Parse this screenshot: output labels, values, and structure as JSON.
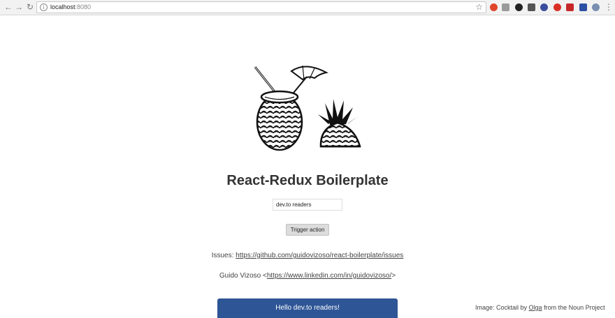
{
  "browser": {
    "url_host": "localhost",
    "url_port": ":8080"
  },
  "page": {
    "title": "React-Redux Boilerplate",
    "input_value": "dev.to readers",
    "trigger_label": "Trigger action",
    "issues_prefix": "Issues:",
    "issues_link": "https://github.com/guidovizoso/react-boilerplate/issues",
    "author_name": "Guido Vizoso <",
    "author_link": "https://www.linkedin.com/in/guidovizoso/",
    "author_suffix": ">",
    "greeting": "Hello dev.to readers!",
    "credit_prefix": "Image: Cocktail by",
    "credit_author": "Olga",
    "credit_suffix": "from the Noun Project"
  },
  "colors": {
    "greeting_bar": "#2e5596"
  }
}
